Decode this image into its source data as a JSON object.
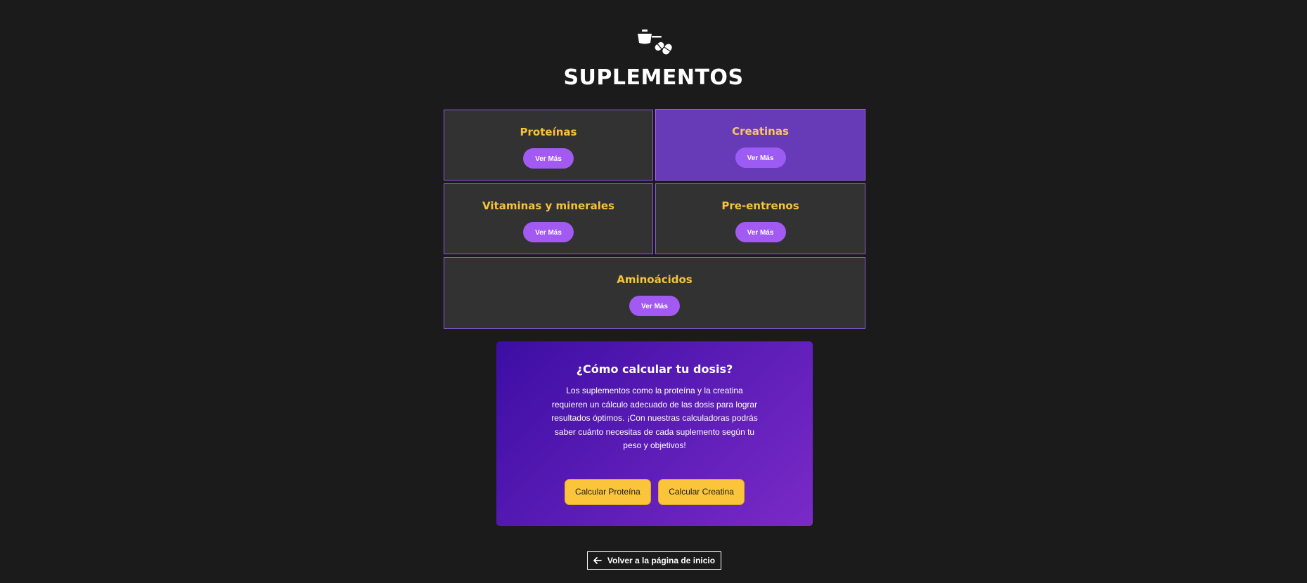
{
  "header": {
    "logo_icon": "supplement-scoop-and-pills-icon",
    "title": "SUPLEMENTOS"
  },
  "categories": [
    {
      "title": "Proteínas",
      "button": "Ver Más",
      "active": false
    },
    {
      "title": "Creatinas",
      "button": "Ver Más",
      "active": true
    },
    {
      "title": "Vitaminas y minerales",
      "button": "Ver Más",
      "active": false
    },
    {
      "title": "Pre-entrenos",
      "button": "Ver Más",
      "active": false
    },
    {
      "title": "Aminoácidos",
      "button": "Ver Más",
      "active": false
    }
  ],
  "calculator": {
    "title": "¿Cómo calcular tu dosis?",
    "text": "Los suplementos como la proteína y la creatina requieren un cálculo adecuado de las dosis para lograr resultados óptimos. ¡Con nuestras calculadoras podrás saber cuánto necesitas de cada suplemento según tu peso y objetivos!",
    "buttons": [
      "Calcular Proteína",
      "Calcular Creatina"
    ]
  },
  "footer": {
    "back_icon": "arrow-left-icon",
    "back_label": "Volver a la página de inicio"
  },
  "colors": {
    "background": "#1b1b1b",
    "card": "#333233",
    "card_active": "#673ab7",
    "accent_purple": "#a25af2",
    "accent_yellow": "#f6c33b"
  }
}
